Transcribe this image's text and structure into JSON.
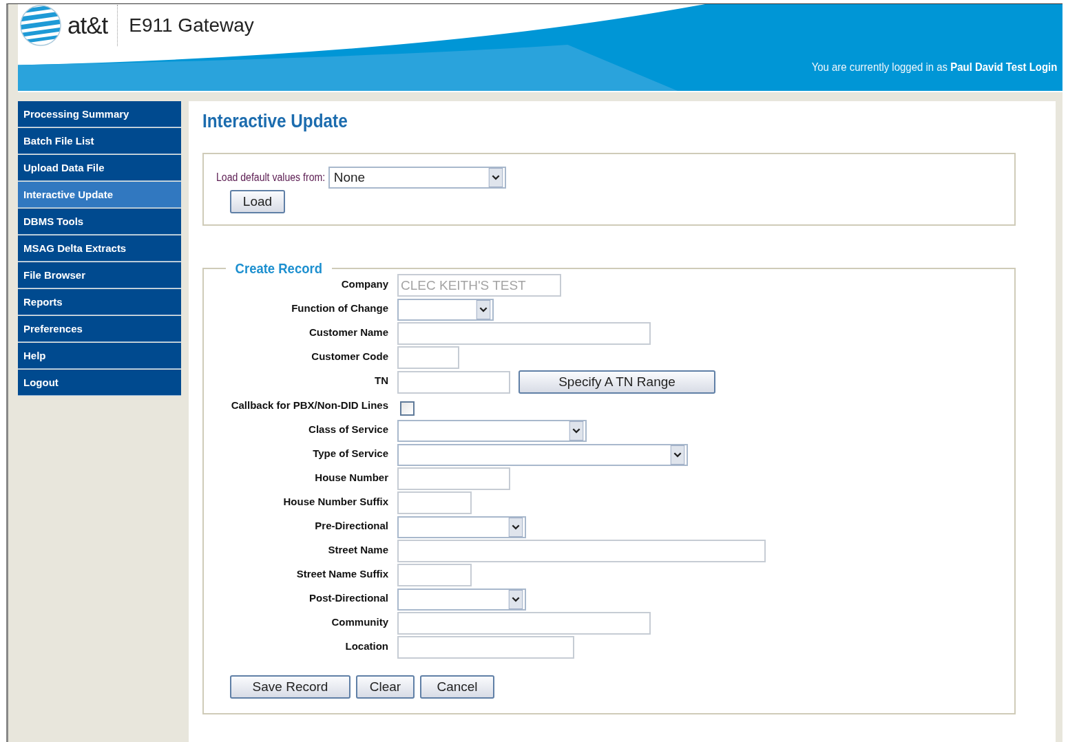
{
  "header": {
    "brand": "at&t",
    "product": "E911 Gateway",
    "login_prefix": "You are currently logged in as ",
    "login_user": "Paul David Test Login"
  },
  "sidebar": {
    "items": [
      {
        "label": "Processing Summary",
        "selected": false
      },
      {
        "label": "Batch File List",
        "selected": false
      },
      {
        "label": "Upload Data File",
        "selected": false
      },
      {
        "label": "Interactive Update",
        "selected": true
      },
      {
        "label": "DBMS Tools",
        "selected": false
      },
      {
        "label": "MSAG Delta Extracts",
        "selected": false
      },
      {
        "label": "File Browser",
        "selected": false
      },
      {
        "label": "Reports",
        "selected": false
      },
      {
        "label": "Preferences",
        "selected": false
      },
      {
        "label": "Help",
        "selected": false
      },
      {
        "label": "Logout",
        "selected": false
      }
    ]
  },
  "page_title": "Interactive Update",
  "defaults": {
    "label": "Load default values from:",
    "value": "None",
    "button": "Load"
  },
  "create_record": {
    "legend": "Create Record",
    "fields": [
      {
        "label": "Company",
        "kind": "text",
        "value": "CLEC KEITH'S TEST",
        "disabled": true
      },
      {
        "label": "Function of Change",
        "kind": "select"
      },
      {
        "label": "Customer Name",
        "kind": "text"
      },
      {
        "label": "Customer Code",
        "kind": "text"
      },
      {
        "label": "TN",
        "kind": "text",
        "button": "Specify A TN Range"
      },
      {
        "label": "Callback for PBX/Non-DID Lines",
        "kind": "checkbox",
        "checked": false
      },
      {
        "label": "Class of Service",
        "kind": "select"
      },
      {
        "label": "Type of Service",
        "kind": "select"
      },
      {
        "label": "House Number",
        "kind": "text"
      },
      {
        "label": "House Number Suffix",
        "kind": "text"
      },
      {
        "label": "Pre-Directional",
        "kind": "select"
      },
      {
        "label": "Street Name",
        "kind": "text"
      },
      {
        "label": "Street Name Suffix",
        "kind": "text"
      },
      {
        "label": "Post-Directional",
        "kind": "select"
      },
      {
        "label": "Community",
        "kind": "text"
      },
      {
        "label": "Location",
        "kind": "text"
      }
    ],
    "buttons": [
      "Save Record",
      "Clear",
      "Cancel"
    ]
  }
}
